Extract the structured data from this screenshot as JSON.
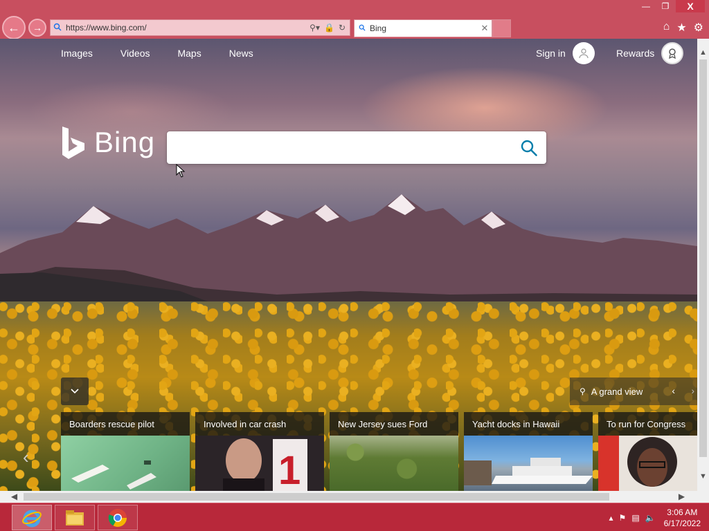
{
  "browser": {
    "url": "https://www.bing.com/",
    "tab_title": "Bing",
    "window_controls": {
      "minimize": "—",
      "restore": "❐",
      "close": "X"
    }
  },
  "bing": {
    "nav": [
      "Images",
      "Videos",
      "Maps",
      "News"
    ],
    "sign_in": "Sign in",
    "rewards": "Rewards",
    "logo_text": "Bing",
    "search_placeholder": ""
  },
  "image_info": {
    "label": "A grand view"
  },
  "news": [
    {
      "title": "Boarders rescue pilot",
      "color": "#7fbf8e"
    },
    {
      "title": "Involved in car crash",
      "color": "#3d3336"
    },
    {
      "title": "New Jersey sues Ford",
      "color": "#5e7a3a"
    },
    {
      "title": "Yacht docks in Hawaii",
      "color": "#6e92b3"
    },
    {
      "title": "To run for Congress",
      "color": "#c9b8a8"
    }
  ],
  "taskbar": {
    "apps": [
      "internet-explorer-icon",
      "file-explorer-icon",
      "chrome-icon"
    ],
    "time": "3:06 AM",
    "date": "6/17/2022"
  },
  "colors": {
    "chrome_accent": "#c84f5f",
    "taskbar": "#b8283a",
    "bing_teal": "#007daa"
  }
}
